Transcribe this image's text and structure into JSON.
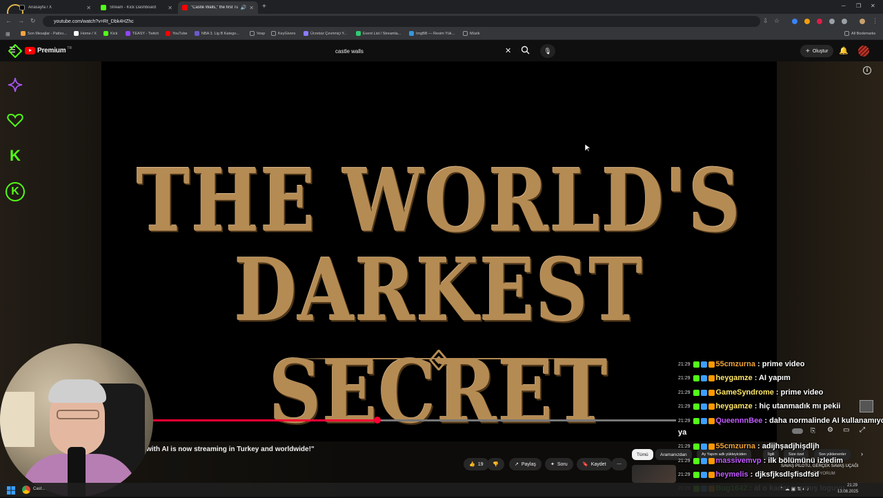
{
  "browser": {
    "tabs": [
      {
        "title": "Anasayfa / X",
        "color": "#1d9bf0",
        "active": false
      },
      {
        "title": "Stream - Kick Dashboard",
        "color": "#53fc18",
        "active": false
      },
      {
        "title": "\"Castle Walls,\" the first Turki",
        "color": "#ff0000",
        "active": true
      }
    ],
    "new_tab": "+",
    "url": "youtube.com/watch?v=Rt_Dbk4HZhc",
    "bookmarks": [
      {
        "label": "Son Mesajlar - Patlıcı...",
        "color": "#f4a340"
      },
      {
        "label": "Home / X",
        "color": "#ffffff"
      },
      {
        "label": "Kick",
        "color": "#53fc18"
      },
      {
        "label": "TEASY - Twitch",
        "color": "#9146ff"
      },
      {
        "label": "YouTube",
        "color": "#ff0000"
      },
      {
        "label": "NBA 3. Lig B Katego...",
        "color": "#6a5acd"
      },
      {
        "label": "Vosp",
        "color": "#888888"
      },
      {
        "label": "KeyGivers",
        "color": "#888888"
      },
      {
        "label": "Ücretsiz Çevrimiçi Y...",
        "color": "#8a7cff"
      },
      {
        "label": "Event List / Streamla...",
        "color": "#2ecc71"
      },
      {
        "label": "ImgBB — Resim Yük...",
        "color": "#3498db"
      },
      {
        "label": "Müzik",
        "color": "#888888"
      }
    ],
    "all_bookmarks": "All Bookmarks"
  },
  "youtube": {
    "logo_text": "Premium",
    "logo_region": "TR",
    "search_query": "castle walls",
    "create_label": "Oluştur",
    "video_title_lines": [
      "THE WORLD'S",
      "DARKEST SECRET"
    ],
    "progress_fraction": 0.43,
    "video_heading": "with AI is now streaming in Turkey and worldwide!\"",
    "like_count": "19",
    "share_label": "Paylaş",
    "ask_label": "Soru",
    "save_label": "Kaydet",
    "chips": [
      "Tümü",
      "Aramanızdan",
      "Ay Yapım adlı yükleyiciden",
      "İlgili",
      "Size özel",
      "Son yüklenenler"
    ],
    "rec_title": "SAVAŞ PİLOTU, GERÇEK SAVAŞ UÇAĞI",
    "rec_sub": "İZLİYORUM"
  },
  "chat": [
    {
      "time": "21:29",
      "user": "55cmzurna",
      "color": "#f1a33a",
      "msg": ": prime video"
    },
    {
      "time": "21:29",
      "user": "heygamze",
      "color": "#ffe66b",
      "msg": ": AI yapım"
    },
    {
      "time": "21:29",
      "user": "GameSyndrome",
      "color": "#ffe66b",
      "msg": ": prime video"
    },
    {
      "time": "21:29",
      "user": "heygamze",
      "color": "#ffe66b",
      "msg": ": hiç utanmadık mı pekii"
    },
    {
      "time": "21:29",
      "user": "QueennnBee",
      "color": "#c15bff",
      "msg": ": daha normalinde AI kullanamıyonuz"
    },
    {
      "time": "",
      "user": "",
      "color": "#ffffff",
      "msg": "ya"
    },
    {
      "time": "21:29",
      "user": "55cmzurna",
      "color": "#f1a33a",
      "msg": ": adijhşadjhişdljh"
    },
    {
      "time": "21:29",
      "user": "massivemvp",
      "color": "#c15bff",
      "msg": ": ilk bölümünü izledim"
    },
    {
      "time": "21:29",
      "user": "heymelis",
      "color": "#c15bff",
      "msg": ": djksfjksdlşfisdfsd"
    },
    {
      "time": "21:29",
      "user": "Bug1642",
      "color": "#53fc18",
      "msg": ": al o kadar yapmış loguyu"
    }
  ],
  "taskbar": {
    "time": "21:29",
    "date": "13.08.2025",
    "chrome_label": "Cast..."
  },
  "colors": {
    "kick_green": "#53fc18",
    "yt_red": "#ff0000",
    "title_gold": "#b58b54"
  }
}
